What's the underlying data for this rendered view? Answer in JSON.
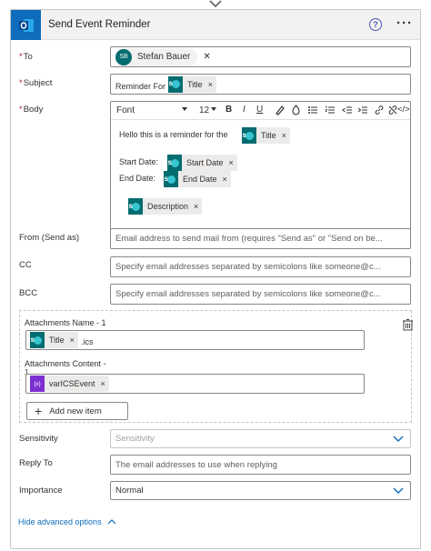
{
  "header": {
    "title": "Send Event Reminder",
    "help_icon": "?",
    "more_icon": "···",
    "brand_color": "#0f6cbd"
  },
  "fields": {
    "to": {
      "label": "To",
      "required_mark": "*",
      "person_initials": "SB",
      "person_name": "Stefan Bauer",
      "remove": "✕"
    },
    "subject": {
      "label": "Subject",
      "required_mark": "*",
      "prefix_text": "Reminder For",
      "token": "Title",
      "remove": "×"
    },
    "body": {
      "label": "Body",
      "required_mark": "*",
      "toolbar": {
        "font": "Font",
        "font_size": "12",
        "bold": "B",
        "italic": "I",
        "underline": "U",
        "code": "</>"
      },
      "line1_text": "Hello this is a reminder for the",
      "line1_token": "Title",
      "line2_text": "Start Date:",
      "line2_token": "Start Date",
      "line3_text": "End Date:",
      "line3_token": "End Date",
      "line4_token": "Description",
      "remove": "×"
    },
    "from": {
      "label": "From (Send as)",
      "placeholder": "Email address to send mail from (requires \"Send as\" or \"Send on be..."
    },
    "cc": {
      "label": "CC",
      "placeholder": "Specify email addresses separated by semicolons like someone@c..."
    },
    "bcc": {
      "label": "BCC",
      "placeholder": "Specify email addresses separated by semicolons like someone@c..."
    }
  },
  "attachments": {
    "name_label": "Attachments Name - 1",
    "name_token": "Title",
    "name_suffix": ".ics",
    "content_label": "Attachments Content -",
    "content_label_num": "1",
    "content_token": "varICSEvent",
    "content_token_glyph": "{x}",
    "remove": "×",
    "add_button": "Add new item",
    "add_plus": "+"
  },
  "options": {
    "sensitivity": {
      "label": "Sensitivity",
      "placeholder": "Sensitivity"
    },
    "reply_to": {
      "label": "Reply To",
      "placeholder": "The email addresses to use when replying"
    },
    "importance": {
      "label": "Importance",
      "value": "Normal"
    }
  },
  "footer": {
    "hide_advanced": "Hide advanced options",
    "chevron": "^"
  },
  "colors": {
    "token_icon_sharepoint": "#036c70",
    "token_icon_variable": "#7b2fd1",
    "link": "#0f6cbd",
    "required": "#a4262c"
  }
}
